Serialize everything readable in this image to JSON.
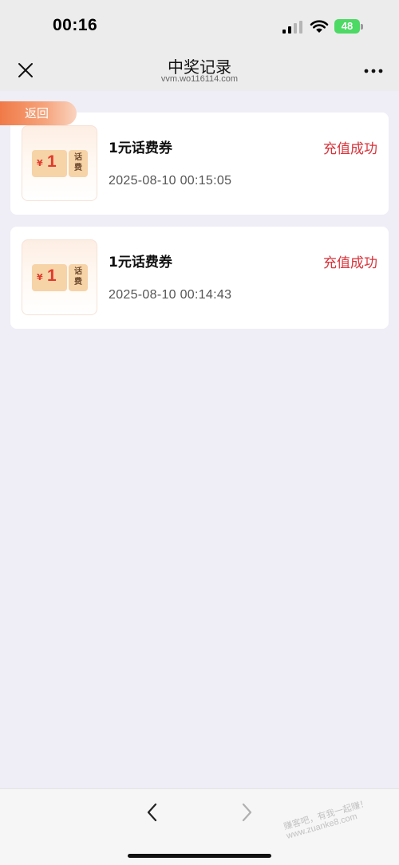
{
  "status_bar": {
    "time": "00:16",
    "battery": "48"
  },
  "nav": {
    "title": "中奖记录",
    "url": "vvm.wo116114.com"
  },
  "back_tab": {
    "label": "返回"
  },
  "records": [
    {
      "title": "1元话费券",
      "status": "充值成功",
      "time": "2025-08-10 00:15:05",
      "coupon": {
        "currency": "¥",
        "amount": "1",
        "stub_line1": "话",
        "stub_line2": "费"
      }
    },
    {
      "title": "1元话费券",
      "status": "充值成功",
      "time": "2025-08-10 00:14:43",
      "coupon": {
        "currency": "¥",
        "amount": "1",
        "stub_line1": "话",
        "stub_line2": "费"
      }
    }
  ],
  "watermark": {
    "line1": "赚客吧，有我一起赚！",
    "line2": "www.zuanke8.com"
  },
  "colors": {
    "page_bg": "#efeef7",
    "status_success": "#d9333a",
    "coupon_red": "#e03a2c",
    "back_tab": "#f07a47"
  }
}
